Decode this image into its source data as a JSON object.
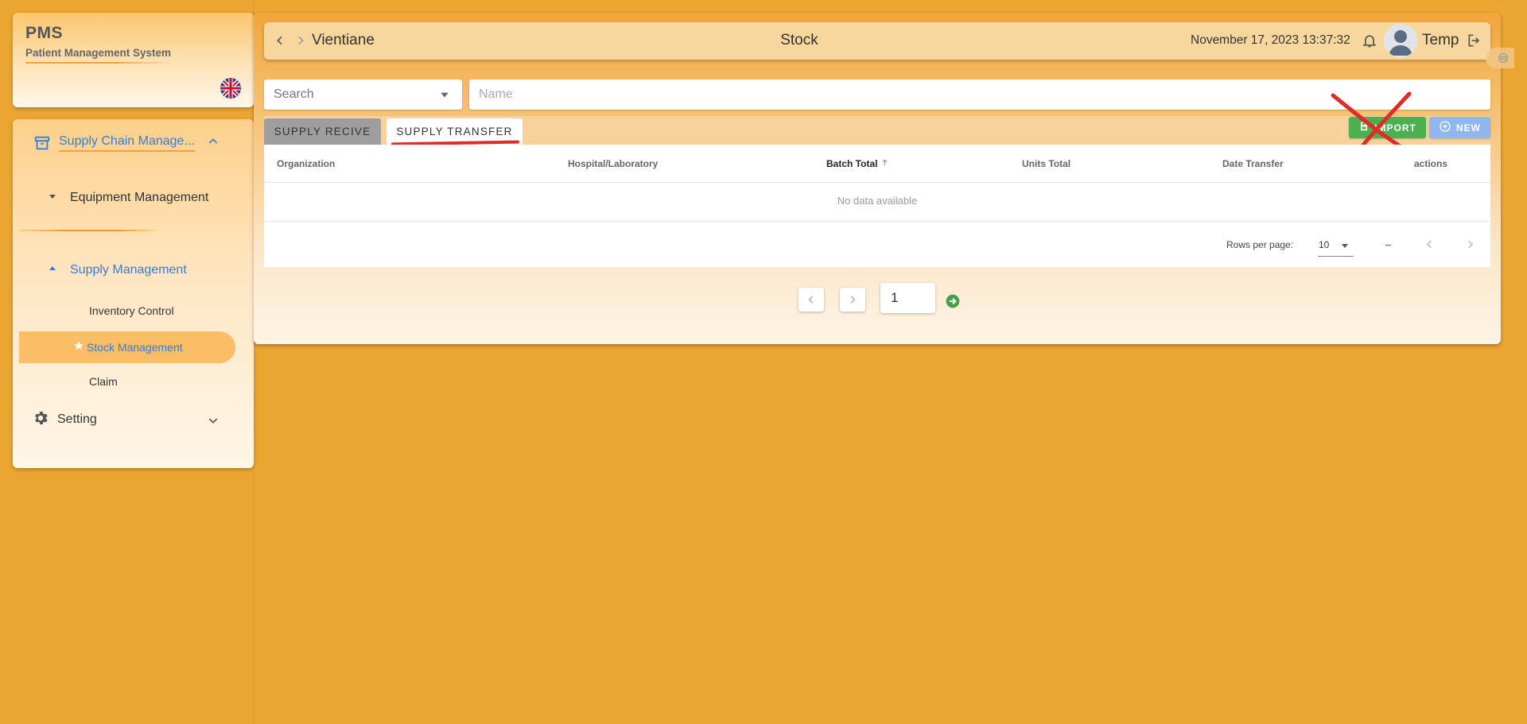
{
  "brand": {
    "title": "PMS",
    "subtitle": "Patient Management System",
    "language_icon": "uk-flag-icon"
  },
  "sidebar": {
    "items": [
      {
        "label": "Supply Chain Manage...",
        "icon": "archive-icon",
        "expanded": true
      },
      {
        "label": "Equipment Management",
        "icon": "caret-down-icon"
      },
      {
        "label": "Supply Management",
        "icon": "caret-up-icon"
      },
      {
        "label": "Inventory Control"
      },
      {
        "label": "Stock Management",
        "icon": "star-icon",
        "active": true
      },
      {
        "label": "Claim"
      },
      {
        "label": "Setting",
        "icon": "gear-icon",
        "expanded": false
      }
    ]
  },
  "topbar": {
    "location": "Vientiane",
    "title": "Stock",
    "datetime": "November 17, 2023 13:37:32",
    "user": "Temp"
  },
  "filters": {
    "search_placeholder": "Search",
    "name_placeholder": "Name"
  },
  "tabs": [
    {
      "label": "SUPPLY RECIVE",
      "active": false
    },
    {
      "label": "SUPPLY TRANSFER",
      "active": true
    }
  ],
  "actions": {
    "import_label": "IMPORT",
    "new_label": "NEW"
  },
  "table": {
    "columns": [
      "Organization",
      "Hospital/Laboratory",
      "Batch Total",
      "Units Total",
      "Date Transfer",
      "actions"
    ],
    "sorted_column": "Batch Total",
    "empty_text": "No data available",
    "rows_per_page_label": "Rows per page:",
    "rows_per_page_value": "10",
    "range_text": "–"
  },
  "pagination": {
    "page": "1"
  },
  "colors": {
    "background": "#eba531",
    "accent_blue": "#3a7bd5",
    "import_green": "#4caf50",
    "new_blue": "#90b6f0",
    "annotation_red": "#e12a2a"
  }
}
